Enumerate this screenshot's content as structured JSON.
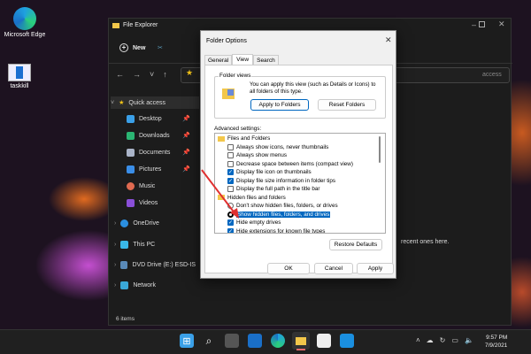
{
  "desktop": {
    "icons": [
      {
        "label": "Microsoft Edge"
      },
      {
        "label": "taskkill"
      }
    ]
  },
  "explorer": {
    "title": "File Explorer",
    "new_label": "New",
    "address_hint": "access",
    "sidebar": [
      {
        "label": "Quick access",
        "color": "#f5c518"
      },
      {
        "label": "Desktop",
        "color": "#3aa0e8",
        "pinned": true
      },
      {
        "label": "Downloads",
        "color": "#2bb673",
        "pinned": true
      },
      {
        "label": "Documents",
        "color": "#aab4c8",
        "pinned": true
      },
      {
        "label": "Pictures",
        "color": "#3a8ee8",
        "pinned": true
      },
      {
        "label": "Music",
        "color": "#e06a50"
      },
      {
        "label": "Videos",
        "color": "#8a4fd8"
      },
      {
        "label": "OneDrive",
        "color": "#2b8fe0"
      },
      {
        "label": "This PC",
        "color": "#3ab8e8"
      },
      {
        "label": "DVD Drive (E:) ESD-IS",
        "color": "#5a8ab8"
      },
      {
        "label": "Network",
        "color": "#3aa8d8"
      }
    ],
    "content_text": "recent ones here.",
    "status": "6 items"
  },
  "dialog": {
    "title": "Folder Options",
    "tabs": [
      "General",
      "View",
      "Search"
    ],
    "active_tab": "View",
    "folder_views_label": "Folder views",
    "folder_views_text": "You can apply this view (such as Details or Icons) to all folders of this type.",
    "apply_folders": "Apply to Folders",
    "reset_folders": "Reset Folders",
    "advanced_label": "Advanced settings:",
    "settings": [
      {
        "type": "folder",
        "label": "Files and Folders"
      },
      {
        "type": "checkbox",
        "label": "Always show icons, never thumbnails",
        "checked": false
      },
      {
        "type": "checkbox",
        "label": "Always show menus",
        "checked": false
      },
      {
        "type": "checkbox",
        "label": "Decrease space between items (compact view)",
        "checked": false
      },
      {
        "type": "checkbox",
        "label": "Display file icon on thumbnails",
        "checked": true
      },
      {
        "type": "checkbox",
        "label": "Display file size information in folder tips",
        "checked": true
      },
      {
        "type": "checkbox",
        "label": "Display the full path in the title bar",
        "checked": false
      },
      {
        "type": "folder",
        "label": "Hidden files and folders"
      },
      {
        "type": "radio",
        "label": "Don't show hidden files, folders, or drives",
        "checked": false
      },
      {
        "type": "radio",
        "label": "Show hidden files, folders, and drives",
        "checked": false,
        "selected": true
      },
      {
        "type": "checkbox",
        "label": "Hide empty drives",
        "checked": true
      },
      {
        "type": "checkbox",
        "label": "Hide extensions for known file types",
        "checked": true
      }
    ],
    "restore_defaults": "Restore Defaults",
    "ok": "OK",
    "cancel": "Cancel",
    "apply": "Apply"
  },
  "taskbar": {
    "time": "9:57 PM",
    "date": "7/9/2021"
  },
  "accent": "#0067c0",
  "arrow_color": "#e03030"
}
